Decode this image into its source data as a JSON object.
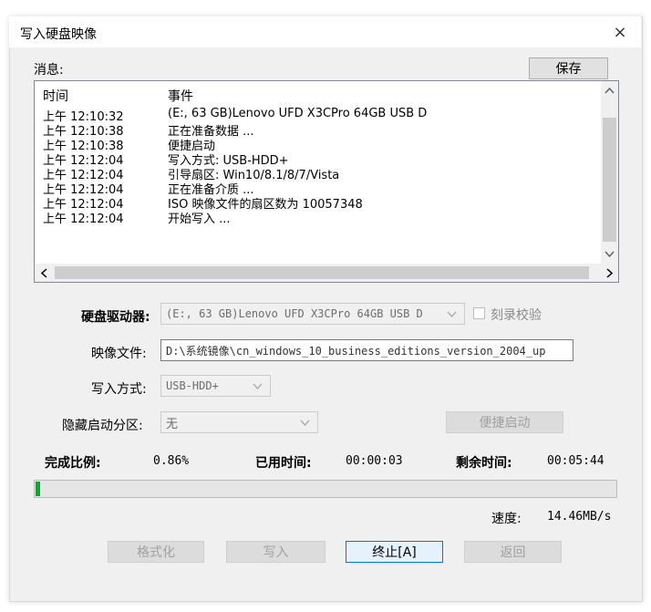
{
  "window": {
    "title": "写入硬盘映像",
    "close_glyph": "×"
  },
  "messages": {
    "label": "消息:",
    "save_button": "保存",
    "columns": {
      "time": "时间",
      "event": "事件"
    },
    "rows": [
      {
        "time": "上午 12:10:32",
        "event": "(E:, 63 GB)Lenovo UFD X3CPro 64GB USB D"
      },
      {
        "time": "上午 12:10:38",
        "event": "正在准备数据 ..."
      },
      {
        "time": "上午 12:10:38",
        "event": "便捷启动"
      },
      {
        "time": "上午 12:12:04",
        "event": "写入方式: USB-HDD+"
      },
      {
        "time": "上午 12:12:04",
        "event": "引导扇区: Win10/8.1/8/7/Vista"
      },
      {
        "time": "上午 12:12:04",
        "event": "正在准备介质 ..."
      },
      {
        "time": "上午 12:12:04",
        "event": "ISO 映像文件的扇区数为 10057348"
      },
      {
        "time": "上午 12:12:04",
        "event": "开始写入 ..."
      }
    ]
  },
  "form": {
    "drive_label": "硬盘驱动器:",
    "drive_value": "(E:, 63 GB)Lenovo UFD X3CPro 64GB USB D",
    "verify_label": "刻录校验",
    "image_label": "映像文件:",
    "image_value": "D:\\系统镜像\\cn_windows_10_business_editions_version_2004_up",
    "write_mode_label": "写入方式:",
    "write_mode_value": "USB-HDD+",
    "hidden_partition_label": "隐藏启动分区:",
    "hidden_partition_value": "无",
    "quick_boot_button": "便捷启动"
  },
  "status": {
    "progress_label": "完成比例:",
    "progress_value": "0.86%",
    "progress_fraction": 0.0086,
    "elapsed_label": "已用时间:",
    "elapsed_value": "00:00:03",
    "remaining_label": "剩余时间:",
    "remaining_value": "00:05:44",
    "speed_label": "速度:",
    "speed_value": "14.46MB/s",
    "progress_color": "#06b025"
  },
  "buttons": {
    "format": "格式化",
    "write": "写入",
    "stop": "终止[A]",
    "back": "返回"
  },
  "icons": {
    "close": "close-icon",
    "scroll_up": "chevron-up-icon",
    "scroll_down": "chevron-down-icon",
    "scroll_left": "chevron-left-icon",
    "scroll_right": "chevron-right-icon",
    "dropdown": "chevron-down-icon"
  }
}
